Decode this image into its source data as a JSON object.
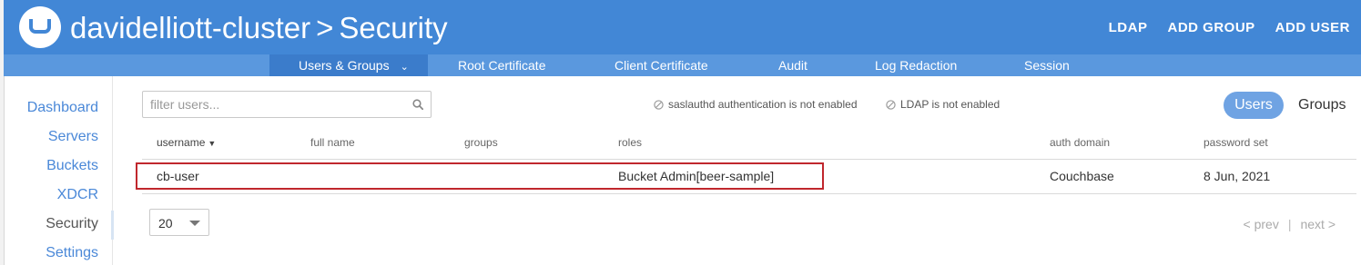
{
  "header": {
    "cluster_name": "davidelliott-cluster",
    "separator": ">",
    "section": "Security",
    "actions": [
      "LDAP",
      "ADD GROUP",
      "ADD USER"
    ]
  },
  "tabs": {
    "users_groups": "Users & Groups",
    "root_certificate": "Root Certificate",
    "client_certificate": "Client Certificate",
    "audit": "Audit",
    "log_redaction": "Log Redaction",
    "session": "Session",
    "active": "Users & Groups"
  },
  "sidebar": {
    "items": [
      "Dashboard",
      "Servers",
      "Buckets",
      "XDCR",
      "Security",
      "Settings"
    ],
    "active": "Security"
  },
  "filter": {
    "placeholder": "filter users...",
    "value": ""
  },
  "notes": {
    "saslauthd": "saslauthd authentication is not enabled",
    "ldap": "LDAP is not enabled"
  },
  "view_toggle": {
    "users": "Users",
    "groups": "Groups",
    "selected": "Users"
  },
  "table": {
    "columns": [
      "username",
      "full name",
      "groups",
      "roles",
      "auth domain",
      "password set"
    ],
    "sort_column": "username",
    "rows": [
      {
        "username": "cb-user",
        "full_name": "",
        "groups": "",
        "roles": "Bucket Admin[beer-sample]",
        "auth_domain": "Couchbase",
        "password_set": "8 Jun, 2021"
      }
    ]
  },
  "pager": {
    "page_size": "20",
    "prev": "< prev",
    "divider": "|",
    "next": "next >"
  },
  "colors": {
    "header_bg": "#4287d6",
    "tabbar_bg": "#5a98de",
    "link": "#4a88d8",
    "highlight_border": "#c0272d"
  }
}
